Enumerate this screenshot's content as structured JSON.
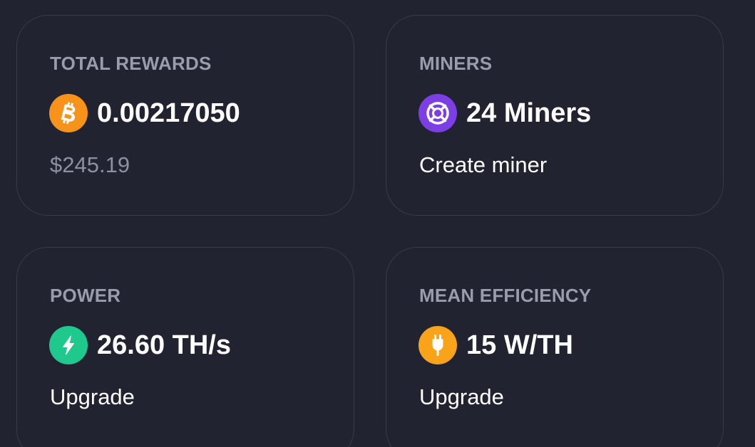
{
  "colors": {
    "background": "#222330",
    "card_border": "#3a3b48",
    "label": "#9a9bab",
    "bitcoin": "#f7931a",
    "miners": "#7b3fe4",
    "power": "#1fc98e",
    "efficiency": "#f9a31a"
  },
  "cards": {
    "rewards": {
      "label": "TOTAL REWARDS",
      "icon": "bitcoin-icon",
      "value": "0.00217050",
      "sub": "$245.19"
    },
    "miners": {
      "label": "MINERS",
      "icon": "miners-icon",
      "value": "24 Miners",
      "sub": "Create miner"
    },
    "power": {
      "label": "POWER",
      "icon": "lightning-icon",
      "value": "26.60 TH/s",
      "sub": "Upgrade"
    },
    "efficiency": {
      "label": "MEAN EFFICIENCY",
      "icon": "plug-icon",
      "value": "15 W/TH",
      "sub": "Upgrade"
    }
  }
}
